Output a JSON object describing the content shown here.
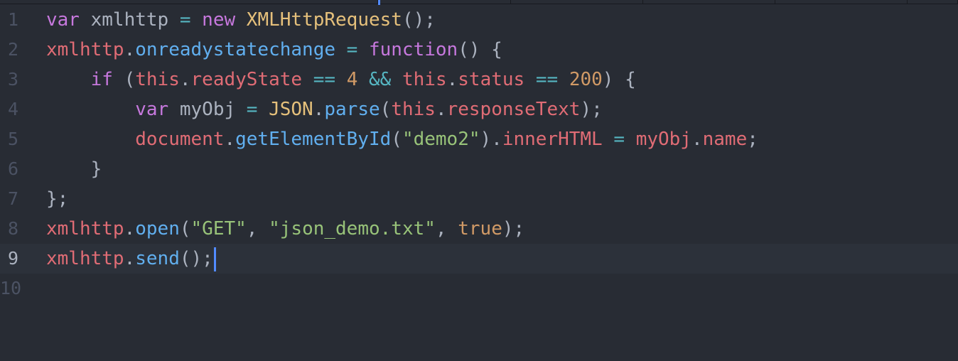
{
  "editor": {
    "lines": [
      {
        "number": "1",
        "tokens": [
          {
            "t": "var",
            "c": "kw"
          },
          {
            "t": " xmlhttp ",
            "c": "pl"
          },
          {
            "t": "=",
            "c": "op"
          },
          {
            "t": " ",
            "c": "pl"
          },
          {
            "t": "new",
            "c": "kw"
          },
          {
            "t": " ",
            "c": "pl"
          },
          {
            "t": "XMLHttpRequest",
            "c": "cls"
          },
          {
            "t": "();",
            "c": "pl"
          }
        ]
      },
      {
        "number": "2",
        "tokens": [
          {
            "t": "xmlhttp",
            "c": "var"
          },
          {
            "t": ".",
            "c": "pl"
          },
          {
            "t": "onreadystatechange",
            "c": "fn"
          },
          {
            "t": " ",
            "c": "pl"
          },
          {
            "t": "=",
            "c": "op"
          },
          {
            "t": " ",
            "c": "pl"
          },
          {
            "t": "function",
            "c": "kw"
          },
          {
            "t": "() {",
            "c": "pl"
          }
        ]
      },
      {
        "number": "3",
        "tokens": [
          {
            "t": "    ",
            "c": "pl"
          },
          {
            "t": "if",
            "c": "kw"
          },
          {
            "t": " (",
            "c": "pl"
          },
          {
            "t": "this",
            "c": "var"
          },
          {
            "t": ".",
            "c": "pl"
          },
          {
            "t": "readyState",
            "c": "var"
          },
          {
            "t": " ",
            "c": "pl"
          },
          {
            "t": "==",
            "c": "op"
          },
          {
            "t": " ",
            "c": "pl"
          },
          {
            "t": "4",
            "c": "num"
          },
          {
            "t": " ",
            "c": "pl"
          },
          {
            "t": "&&",
            "c": "op"
          },
          {
            "t": " ",
            "c": "pl"
          },
          {
            "t": "this",
            "c": "var"
          },
          {
            "t": ".",
            "c": "pl"
          },
          {
            "t": "status",
            "c": "var"
          },
          {
            "t": " ",
            "c": "pl"
          },
          {
            "t": "==",
            "c": "op"
          },
          {
            "t": " ",
            "c": "pl"
          },
          {
            "t": "200",
            "c": "num"
          },
          {
            "t": ") {",
            "c": "pl"
          }
        ]
      },
      {
        "number": "4",
        "tokens": [
          {
            "t": "        ",
            "c": "pl"
          },
          {
            "t": "var",
            "c": "kw"
          },
          {
            "t": " myObj ",
            "c": "pl"
          },
          {
            "t": "=",
            "c": "op"
          },
          {
            "t": " ",
            "c": "pl"
          },
          {
            "t": "JSON",
            "c": "cls"
          },
          {
            "t": ".",
            "c": "pl"
          },
          {
            "t": "parse",
            "c": "fn"
          },
          {
            "t": "(",
            "c": "pl"
          },
          {
            "t": "this",
            "c": "var"
          },
          {
            "t": ".",
            "c": "pl"
          },
          {
            "t": "responseText",
            "c": "var"
          },
          {
            "t": ");",
            "c": "pl"
          }
        ]
      },
      {
        "number": "5",
        "tokens": [
          {
            "t": "        ",
            "c": "pl"
          },
          {
            "t": "document",
            "c": "var"
          },
          {
            "t": ".",
            "c": "pl"
          },
          {
            "t": "getElementById",
            "c": "fn"
          },
          {
            "t": "(",
            "c": "pl"
          },
          {
            "t": "\"demo2\"",
            "c": "str"
          },
          {
            "t": ").",
            "c": "pl"
          },
          {
            "t": "innerHTML",
            "c": "var"
          },
          {
            "t": " ",
            "c": "pl"
          },
          {
            "t": "=",
            "c": "op"
          },
          {
            "t": " ",
            "c": "pl"
          },
          {
            "t": "myObj",
            "c": "var"
          },
          {
            "t": ".",
            "c": "pl"
          },
          {
            "t": "name",
            "c": "var"
          },
          {
            "t": ";",
            "c": "pl"
          }
        ]
      },
      {
        "number": "6",
        "tokens": [
          {
            "t": "    }",
            "c": "pl"
          }
        ]
      },
      {
        "number": "7",
        "tokens": [
          {
            "t": "};",
            "c": "pl"
          }
        ]
      },
      {
        "number": "8",
        "tokens": [
          {
            "t": "xmlhttp",
            "c": "var"
          },
          {
            "t": ".",
            "c": "pl"
          },
          {
            "t": "open",
            "c": "fn"
          },
          {
            "t": "(",
            "c": "pl"
          },
          {
            "t": "\"GET\"",
            "c": "str"
          },
          {
            "t": ", ",
            "c": "pl"
          },
          {
            "t": "\"json_demo.txt\"",
            "c": "str"
          },
          {
            "t": ", ",
            "c": "pl"
          },
          {
            "t": "true",
            "c": "num"
          },
          {
            "t": ");",
            "c": "pl"
          }
        ]
      },
      {
        "number": "9",
        "current": true,
        "tokens": [
          {
            "t": "xmlhttp",
            "c": "var"
          },
          {
            "t": ".",
            "c": "pl"
          },
          {
            "t": "send",
            "c": "fn"
          },
          {
            "t": "();",
            "c": "pl"
          }
        ]
      },
      {
        "number": "10",
        "tokens": []
      }
    ]
  },
  "colors": {
    "background": "#282c34",
    "current_line": "#2c313a",
    "keyword": "#c678dd",
    "variable": "#e06c75",
    "function": "#61afef",
    "class": "#e5c07b",
    "operator": "#56b6c2",
    "number": "#d19a66",
    "string": "#98c379",
    "plain": "#abb2bf",
    "cursor": "#528bff"
  }
}
